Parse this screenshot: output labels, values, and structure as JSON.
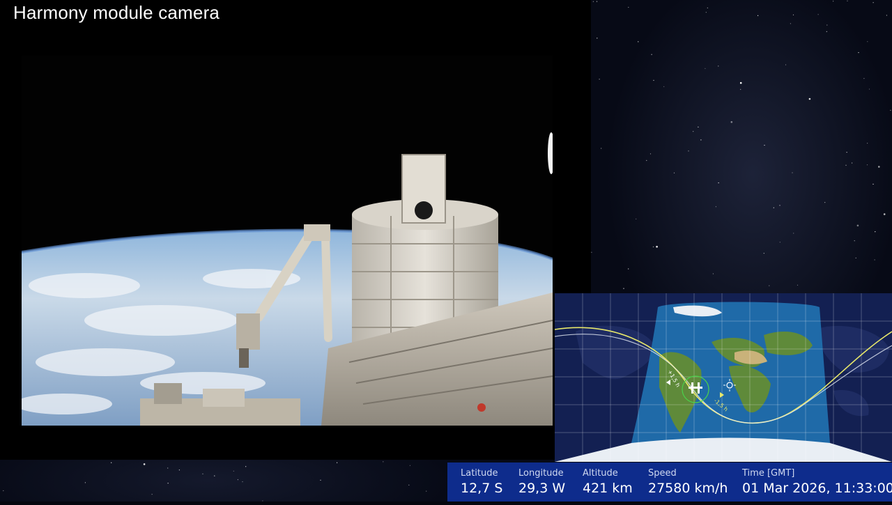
{
  "camera": {
    "title": "Harmony module camera",
    "feed_description": "space-station-exterior-view"
  },
  "tracker": {
    "map_label": "world-map-ground-track",
    "track_marker_left": "+1,5 h",
    "track_marker_right": "-1,5 h",
    "sun_icon": "sun-icon",
    "station_icon": "space-station-icon",
    "colors": {
      "night": "#132052",
      "day_ocean": "#1f6aa8",
      "track_future": "#e8e86a",
      "track_past": "#e6ecf5"
    }
  },
  "telemetry": [
    {
      "label": "Latitude",
      "value": "12,7 S"
    },
    {
      "label": "Longitude",
      "value": "29,3 W"
    },
    {
      "label": "Altitude",
      "value": "421 km"
    },
    {
      "label": "Speed",
      "value": "27580 km/h"
    },
    {
      "label": "Time [GMT]",
      "value": "01 Mar 2026, 11:33:00"
    }
  ],
  "colors": {
    "telemetry_bg": "#0e2c8c",
    "panel_bg": "#000000"
  }
}
